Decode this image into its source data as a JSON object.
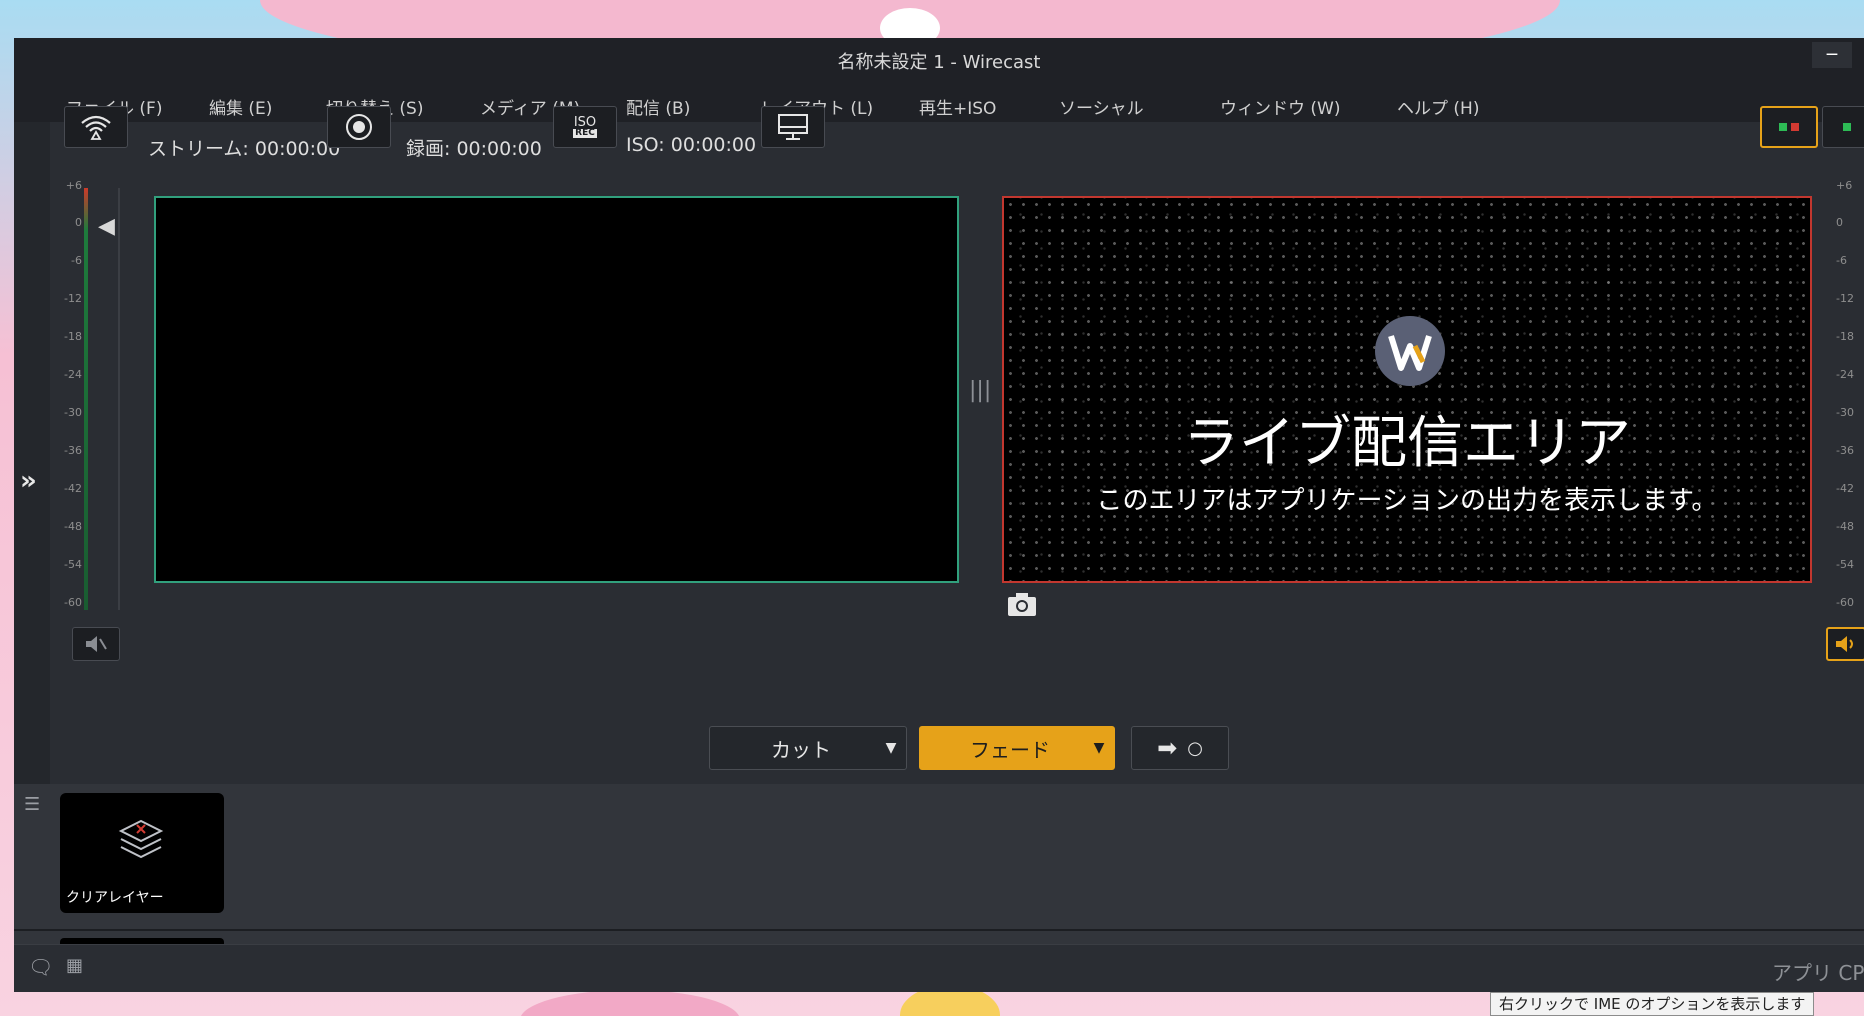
{
  "window": {
    "title": "名称未設定 1 - Wirecast",
    "minimize_glyph": "‒"
  },
  "menu": [
    {
      "label": "ファイル (F)"
    },
    {
      "label": "編集 (E)"
    },
    {
      "label": "切り替え (S)"
    },
    {
      "label": "メディア (M)"
    },
    {
      "label": "配信 (B)"
    },
    {
      "label": "レイアウト (L)"
    },
    {
      "label": "再生+ISO"
    },
    {
      "label": "ソーシャル"
    },
    {
      "label": "ウィンドウ (W)"
    },
    {
      "label": "ヘルプ (H)"
    }
  ],
  "toolbar": {
    "stream_label": "ストリーム:",
    "stream_time": "00:00:00",
    "record_label": "録画:",
    "record_time": "00:00:00",
    "iso_badge_top": "ISO",
    "iso_badge_bottom": "REC",
    "iso_label": "ISO:",
    "iso_time": "00:00:00"
  },
  "meter_scale": [
    "+6",
    "0",
    "-6",
    "-12",
    "-18",
    "-24",
    "-30",
    "-36",
    "-42",
    "-48",
    "-54",
    "-60"
  ],
  "live": {
    "title": "ライブ配信エリア",
    "subtitle": "このエリアはアプリケーションの出力を表示します。"
  },
  "transitions": {
    "cut_label": "カット",
    "fade_label": "フェード",
    "go_label": "○"
  },
  "shots": [
    {
      "label": "クリアレイヤー"
    }
  ],
  "status": {
    "cpu_label": "アプリ CP"
  },
  "tooltip": {
    "text": "右クリックで IME のオプションを表示します"
  },
  "colors": {
    "preview_border": "#31a07d",
    "live_border": "#c2372f",
    "accent": "#e6a219"
  }
}
